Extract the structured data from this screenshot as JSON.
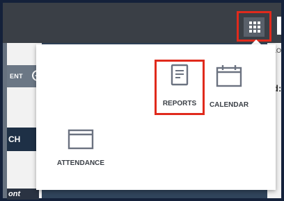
{
  "topbar": {
    "apps_button_icon": "apps-grid-icon"
  },
  "left_panel": {
    "client_label": "ENT",
    "client_action_icon": "plus-circle-icon",
    "ch_label": "CH",
    "ont_label": "ont"
  },
  "right_panel": {
    "colon_label": "d:",
    "partial_top_label": "LO"
  },
  "apps_menu": {
    "items": [
      {
        "label": "REPORTS",
        "icon": "document-icon"
      },
      {
        "label": "CALENDAR",
        "icon": "calendar-icon"
      },
      {
        "label": "ATTENDANCE",
        "icon": "browser-window-icon"
      }
    ]
  },
  "colors": {
    "highlight": "#e02a1c",
    "icon_gray": "#6b7280",
    "topbar": "#3a3f46"
  }
}
